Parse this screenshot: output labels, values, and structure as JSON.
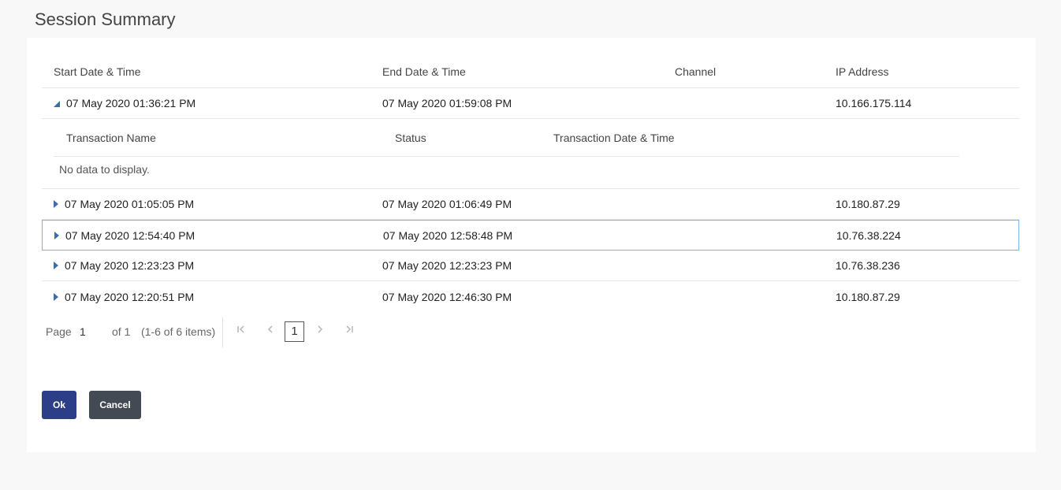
{
  "page": {
    "title": "Session Summary"
  },
  "table": {
    "columns": [
      "Start Date & Time",
      "End Date & Time",
      "Channel",
      "IP Address"
    ],
    "rows": [
      {
        "start": "07 May 2020 01:36:21 PM",
        "end": "07 May 2020 01:59:08 PM",
        "channel": "",
        "ip": "10.166.175.114",
        "expanded": true
      },
      {
        "start": "07 May 2020 01:05:05 PM",
        "end": "07 May 2020 01:06:49 PM",
        "channel": "",
        "ip": "10.180.87.29",
        "expanded": false
      },
      {
        "start": "07 May 2020 12:54:40 PM",
        "end": "07 May 2020 12:58:48 PM",
        "channel": "",
        "ip": "10.76.38.224",
        "expanded": false,
        "selected": true
      },
      {
        "start": "07 May 2020 12:23:23 PM",
        "end": "07 May 2020 12:23:23 PM",
        "channel": "",
        "ip": "10.76.38.236",
        "expanded": false
      },
      {
        "start": "07 May 2020 12:20:51 PM",
        "end": "07 May 2020 12:46:30 PM",
        "channel": "",
        "ip": "10.180.87.29",
        "expanded": false
      }
    ],
    "detail": {
      "columns": [
        "Transaction Name",
        "Status",
        "Transaction Date & Time"
      ],
      "empty_message": "No data to display."
    }
  },
  "pager": {
    "page_label": "Page",
    "page_value": "1",
    "of_label": "of 1",
    "items_label": "(1-6 of 6 items)",
    "current": "1",
    "first_icon": "first-page-icon",
    "prev_icon": "prev-page-icon",
    "next_icon": "next-page-icon",
    "last_icon": "last-page-icon"
  },
  "buttons": {
    "ok": "Ok",
    "cancel": "Cancel"
  },
  "colors": {
    "primary": "#2c3e87",
    "secondary": "#434a54",
    "accent": "#3a6ea5",
    "selected_border": "#7fb2e8"
  }
}
